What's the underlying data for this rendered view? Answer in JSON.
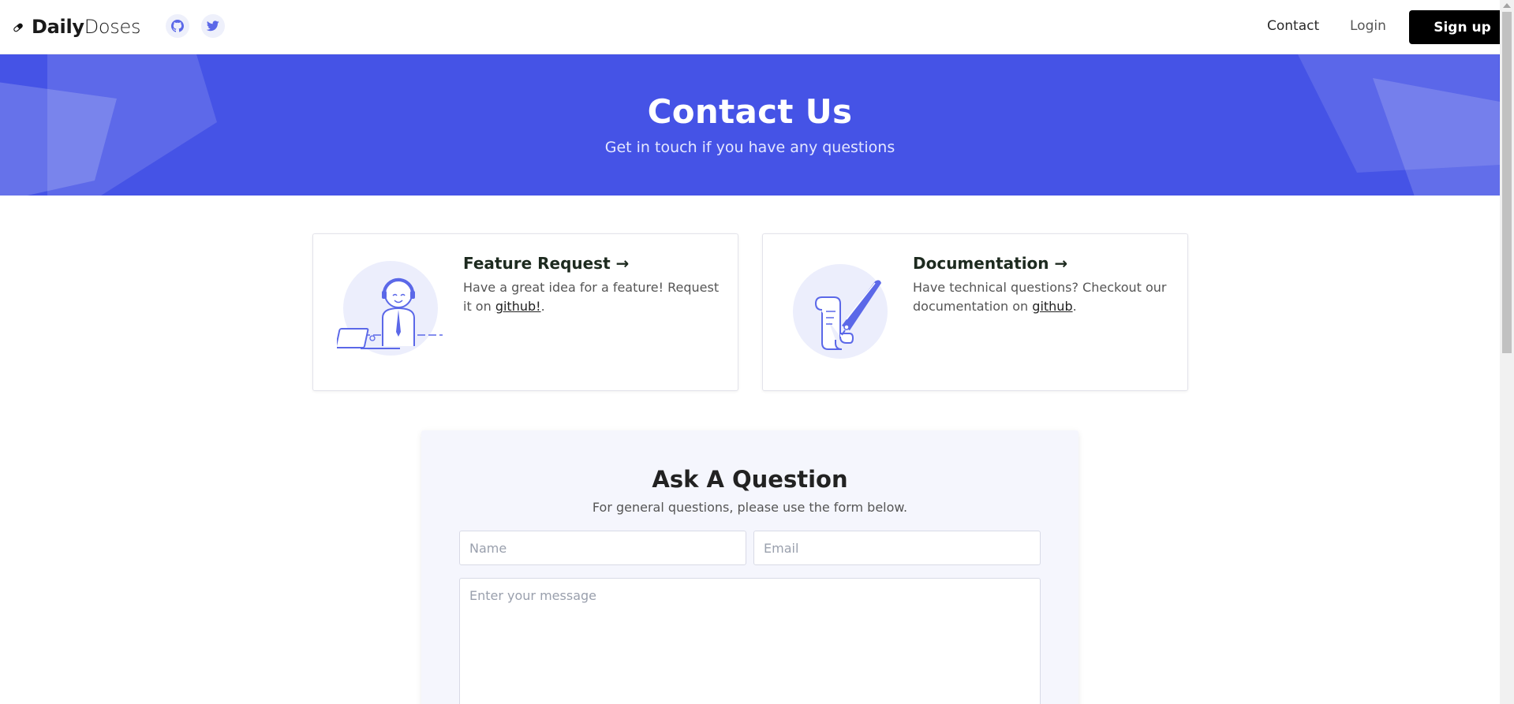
{
  "brand": {
    "bold": "Daily",
    "light": "Doses"
  },
  "social": [
    {
      "name": "github-icon"
    },
    {
      "name": "twitter-icon"
    }
  ],
  "nav": {
    "contact": "Contact",
    "login": "Login",
    "signup": "Sign up"
  },
  "hero": {
    "title": "Contact Us",
    "subtitle": "Get in touch if you have any questions"
  },
  "cards": {
    "feature": {
      "title": "Feature Request →",
      "text_before": "Have a great idea for a feature! Request it on ",
      "link": "github!",
      "text_after": "."
    },
    "docs": {
      "title": "Documentation →",
      "text_before": "Have technical questions? Checkout our documentation on ",
      "link": "github",
      "text_after": "."
    }
  },
  "form": {
    "title": "Ask A Question",
    "subtitle": "For general questions, please use the form below.",
    "name_placeholder": "Name",
    "email_placeholder": "Email",
    "message_placeholder": "Enter your message"
  },
  "colors": {
    "hero_bg": "#4553e6",
    "accent": "#5b68e8",
    "form_bg": "#f5f6fd",
    "signup_bg": "#000000"
  }
}
